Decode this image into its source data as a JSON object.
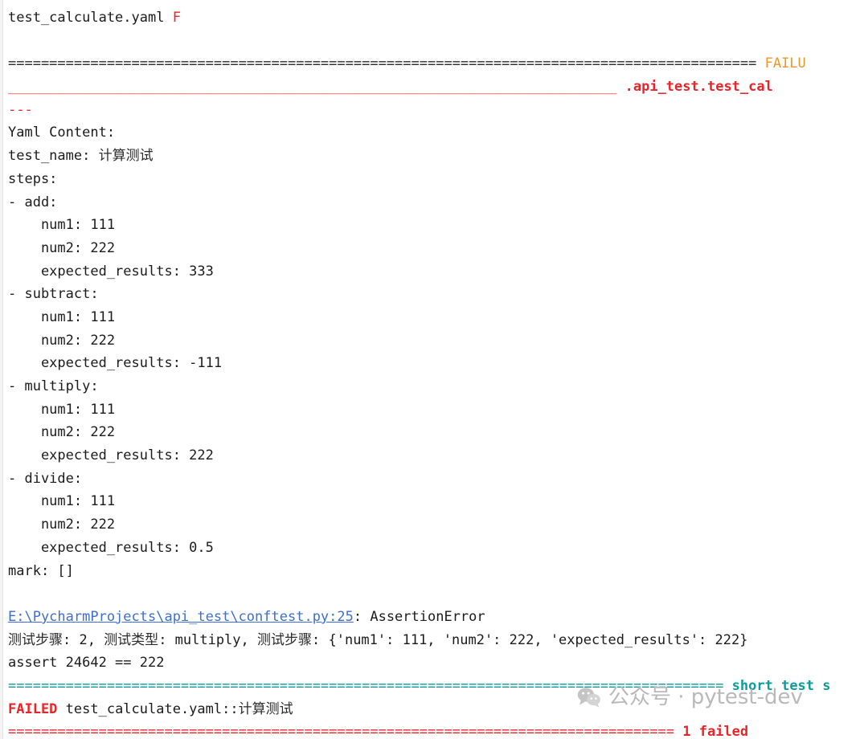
{
  "console": {
    "title": "pytest terminal output",
    "colors": {
      "default": "#1b1b1b",
      "red": "#e8252b",
      "orange": "#e9962e",
      "teal": "#0f9b9b",
      "link": "#3b6fd4",
      "watermark": "#b9b9b9",
      "background": "#ffffff"
    },
    "lines": [
      {
        "id": "collect-result",
        "segments": [
          {
            "text": "test_calculate.yaml ",
            "color": "default"
          },
          {
            "text": "F",
            "color": "red"
          }
        ]
      },
      {
        "id": "blank-1",
        "segments": [
          {
            "text": " ",
            "color": "default"
          }
        ]
      },
      {
        "id": "failures-banner",
        "segments": [
          {
            "text": "=========================================================================================== ",
            "color": "dark"
          },
          {
            "text": "FAILU",
            "color": "orange"
          }
        ]
      },
      {
        "id": "test-header",
        "segments": [
          {
            "text": "__________________________________________________________________________ ",
            "color": "red"
          },
          {
            "text": ".api_test.test_cal",
            "color": "redb"
          }
        ]
      },
      {
        "id": "yaml-sep",
        "segments": [
          {
            "text": "---",
            "color": "red"
          }
        ]
      },
      {
        "id": "yaml-content-label",
        "segments": [
          {
            "text": "Yaml Content:",
            "color": "default"
          }
        ]
      },
      {
        "id": "yaml-test-name",
        "segments": [
          {
            "text": "test_name: ",
            "color": "default"
          },
          {
            "text": "计算测试",
            "color": "cjk"
          }
        ]
      },
      {
        "id": "yaml-steps-key",
        "segments": [
          {
            "text": "steps:",
            "color": "default"
          }
        ]
      },
      {
        "id": "yaml-step-add",
        "segments": [
          {
            "text": "- add:",
            "color": "default"
          }
        ]
      },
      {
        "id": "yaml-add-num1",
        "segments": [
          {
            "text": "    num1: 111",
            "color": "default"
          }
        ]
      },
      {
        "id": "yaml-add-num2",
        "segments": [
          {
            "text": "    num2: 222",
            "color": "default"
          }
        ]
      },
      {
        "id": "yaml-add-expected",
        "segments": [
          {
            "text": "    expected_results: 333",
            "color": "default"
          }
        ]
      },
      {
        "id": "yaml-step-subtract",
        "segments": [
          {
            "text": "- subtract:",
            "color": "default"
          }
        ]
      },
      {
        "id": "yaml-subtract-num1",
        "segments": [
          {
            "text": "    num1: 111",
            "color": "default"
          }
        ]
      },
      {
        "id": "yaml-subtract-num2",
        "segments": [
          {
            "text": "    num2: 222",
            "color": "default"
          }
        ]
      },
      {
        "id": "yaml-subtract-expected",
        "segments": [
          {
            "text": "    expected_results: -111",
            "color": "default"
          }
        ]
      },
      {
        "id": "yaml-step-multiply",
        "segments": [
          {
            "text": "- multiply:",
            "color": "default"
          }
        ]
      },
      {
        "id": "yaml-multiply-num1",
        "segments": [
          {
            "text": "    num1: 111",
            "color": "default"
          }
        ]
      },
      {
        "id": "yaml-multiply-num2",
        "segments": [
          {
            "text": "    num2: 222",
            "color": "default"
          }
        ]
      },
      {
        "id": "yaml-multiply-expected",
        "segments": [
          {
            "text": "    expected_results: 222",
            "color": "default"
          }
        ]
      },
      {
        "id": "yaml-step-divide",
        "segments": [
          {
            "text": "- divide:",
            "color": "default"
          }
        ]
      },
      {
        "id": "yaml-divide-num1",
        "segments": [
          {
            "text": "    num1: 111",
            "color": "default"
          }
        ]
      },
      {
        "id": "yaml-divide-num2",
        "segments": [
          {
            "text": "    num2: 222",
            "color": "default"
          }
        ]
      },
      {
        "id": "yaml-divide-expected",
        "segments": [
          {
            "text": "    expected_results: 0.5",
            "color": "default"
          }
        ]
      },
      {
        "id": "yaml-mark",
        "segments": [
          {
            "text": "mark: []",
            "color": "default"
          }
        ]
      },
      {
        "id": "blank-2",
        "segments": [
          {
            "text": " ",
            "color": "default"
          }
        ]
      },
      {
        "id": "traceback-location",
        "segments": [
          {
            "text": "E:\\PycharmProjects\\api_test\\conftest.py:25",
            "color": "link"
          },
          {
            "text": ": AssertionError",
            "color": "default"
          }
        ]
      },
      {
        "id": "assert-detail-cjk",
        "segments": [
          {
            "text": "测试步骤",
            "color": "cjk"
          },
          {
            "text": ": 2, ",
            "color": "default"
          },
          {
            "text": "测试类型",
            "color": "cjk"
          },
          {
            "text": ": multiply, ",
            "color": "default"
          },
          {
            "text": "测试步骤",
            "color": "cjk"
          },
          {
            "text": ": {'num1': 111, 'num2': 222, 'expected_results': 222}",
            "color": "default"
          }
        ]
      },
      {
        "id": "assert-statement",
        "segments": [
          {
            "text": "assert 24642 == 222",
            "color": "default"
          }
        ]
      },
      {
        "id": "short-summary-banner",
        "segments": [
          {
            "text": "======================================================================================= ",
            "color": "teal"
          },
          {
            "text": "short test s",
            "color": "tealb"
          }
        ]
      },
      {
        "id": "failed-summary",
        "segments": [
          {
            "text": "FAILED",
            "color": "redb"
          },
          {
            "text": " test_calculate.yaml::",
            "color": "default"
          },
          {
            "text": "计算测试",
            "color": "cjk"
          }
        ]
      },
      {
        "id": "final-banner",
        "segments": [
          {
            "text": "================================================================================= ",
            "color": "red"
          },
          {
            "text": "1 failed",
            "color": "redb"
          }
        ]
      }
    ]
  },
  "watermark": {
    "icon": "wechat-icon",
    "label": "公众号 · pytest-dev"
  }
}
